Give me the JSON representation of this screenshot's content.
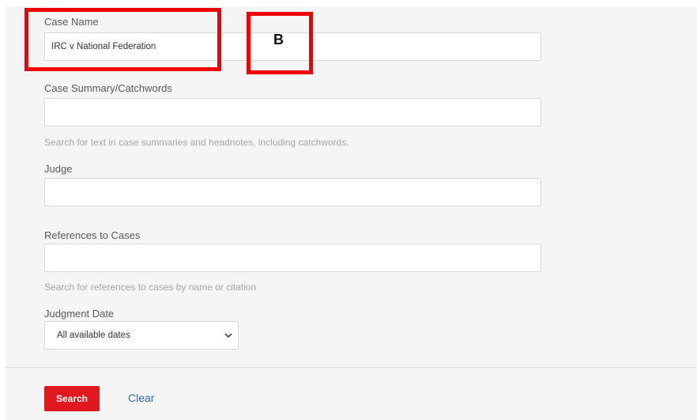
{
  "form": {
    "case_name": {
      "label": "Case Name",
      "value": "IRC v National Federation"
    },
    "case_summary": {
      "label": "Case Summary/Catchwords",
      "value": "",
      "help": "Search for text in case summaries and headnotes, including catchwords."
    },
    "judge": {
      "label": "Judge",
      "value": ""
    },
    "references": {
      "label": "References to Cases",
      "value": "",
      "help": "Search for references to cases by name or citation"
    },
    "judgment_date": {
      "label": "Judgment Date",
      "selected": "All available dates",
      "icon": "chevron-down-icon"
    }
  },
  "actions": {
    "search_label": "Search",
    "clear_label": "Clear"
  },
  "annotations": {
    "letter": "B",
    "color": "#ee0000"
  },
  "colors": {
    "search_button": "#e0171e",
    "link": "#2f6fb5"
  }
}
